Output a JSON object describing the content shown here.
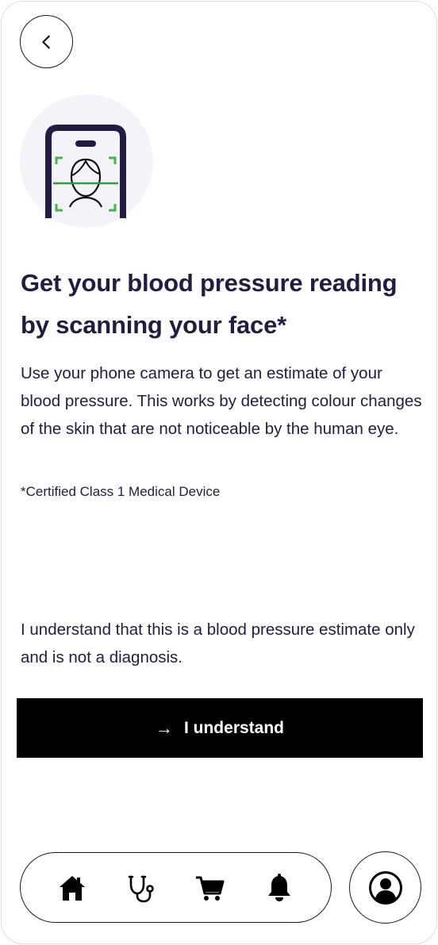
{
  "header": {
    "back_icon": "chevron-left-icon"
  },
  "hero": {
    "icon": "phone-face-scan-icon",
    "colors": {
      "phone": "#231c42",
      "scan_brackets": "#4caf50",
      "scan_line": "#2e9e3a",
      "circle_bg": "#f4f3f9"
    }
  },
  "content": {
    "title": "Get your blood pressure reading by scanning your face*",
    "description": "Use your phone camera to get an estimate of your blood pressure. This works by detecting colour changes of the skin that are not noticeable by the human eye.",
    "certification": "*Certified Class 1 Medical Device",
    "disclaimer": "I understand that this is a blood pressure estimate only and is not a diagnosis."
  },
  "cta": {
    "arrow": "→",
    "label": "I understand",
    "background": "#000000",
    "text_color": "#ffffff"
  },
  "tabbar": {
    "items": [
      {
        "icon": "home-icon"
      },
      {
        "icon": "stethoscope-icon"
      },
      {
        "icon": "cart-icon"
      },
      {
        "icon": "bell-icon"
      }
    ],
    "profile_icon": "user-profile-icon"
  }
}
